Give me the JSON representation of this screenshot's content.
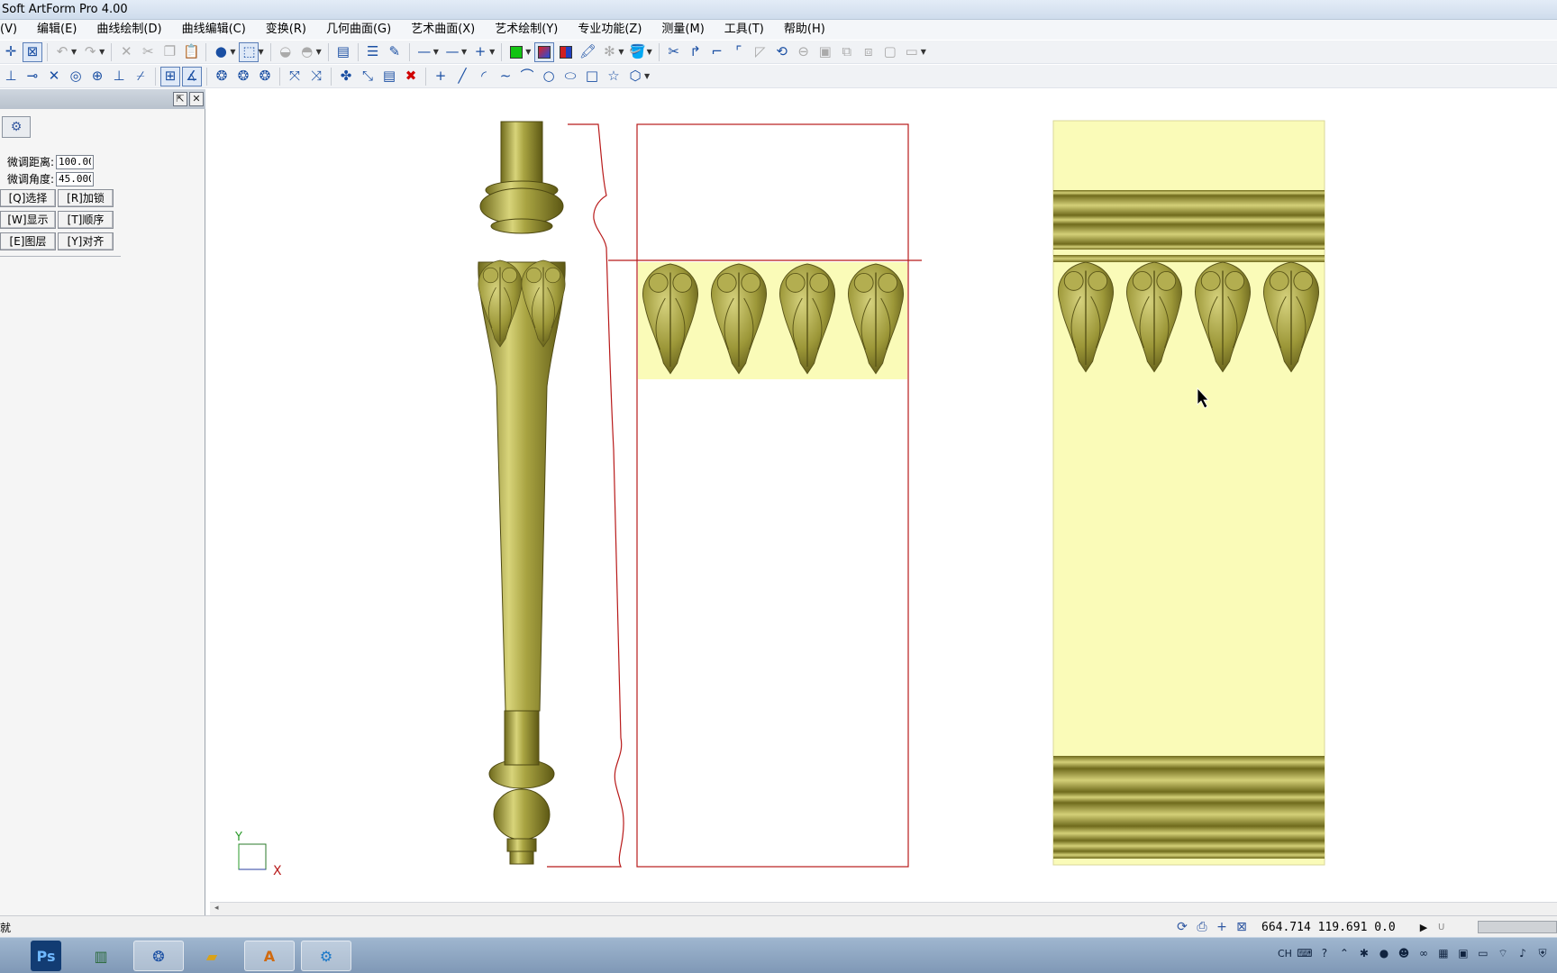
{
  "window": {
    "title": "Soft ArtForm Pro 4.00"
  },
  "menu": [
    "(V)",
    "编辑(E)",
    "曲线绘制(D)",
    "曲线编辑(C)",
    "变换(R)",
    "几何曲面(G)",
    "艺术曲面(X)",
    "艺术绘制(Y)",
    "专业功能(Z)",
    "测量(M)",
    "工具(T)",
    "帮助(H)"
  ],
  "panel": {
    "fields": [
      {
        "label": "微调距离:",
        "value": "100.00"
      },
      {
        "label": "微调角度:",
        "value": "45.000"
      }
    ],
    "buttons": [
      {
        "label": "[Q]选择"
      },
      {
        "label": "[R]加锁"
      },
      {
        "label": "[W]显示"
      },
      {
        "label": "[T]顺序"
      },
      {
        "label": "[E]图层"
      },
      {
        "label": "[Y]对齐"
      }
    ]
  },
  "canvas": {
    "axis_y": "Y",
    "axis_x": "X"
  },
  "status": {
    "left_text": "就",
    "coords": "664.714  119.691  0.0",
    "unit": "U"
  },
  "taskbar": {
    "apps": [
      "Ps",
      "file-manager",
      "artform-app",
      "folder",
      "A",
      "tool-app"
    ],
    "tray_lang": "CH"
  },
  "colors": {
    "relief": "#8f8a2a",
    "relief_light": "#c9c56a",
    "relief_bg": "#fafbb8",
    "outline": "#b81a1a",
    "accent": "#1a4fa3"
  }
}
